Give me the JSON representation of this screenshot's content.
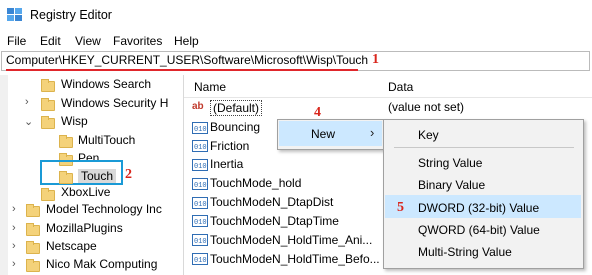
{
  "window": {
    "title": "Registry Editor"
  },
  "menu": [
    "File",
    "Edit",
    "View",
    "Favorites",
    "Help"
  ],
  "address": {
    "path": "Computer\\HKEY_CURRENT_USER\\Software\\Microsoft\\Wisp\\Touch"
  },
  "annotations": {
    "n1": "1",
    "n2": "2",
    "n4": "4",
    "n5": "5",
    "color": "#d9261c"
  },
  "tree": {
    "windows_search": "Windows Search",
    "windows_security": "Windows Security H",
    "wisp": "Wisp",
    "multitouch": "MultiTouch",
    "pen": "Pen",
    "touch": "Touch",
    "xboxlive": "XboxLive",
    "model_tech": "Model Technology Inc",
    "mozilla": "MozillaPlugins",
    "netscape": "Netscape",
    "nicomak": "Nico Mak Computing"
  },
  "columns": {
    "name": "Name",
    "data": "Data"
  },
  "values": [
    {
      "name": "(Default)",
      "data": "(value not set)",
      "icon": "string-value-icon"
    },
    {
      "name": "Bouncing",
      "icon": "dword-value-icon"
    },
    {
      "name": "Friction",
      "icon": "dword-value-icon"
    },
    {
      "name": "Inertia",
      "icon": "dword-value-icon"
    },
    {
      "name": "TouchMode_hold",
      "icon": "dword-value-icon"
    },
    {
      "name": "TouchModeN_DtapDist",
      "icon": "dword-value-icon"
    },
    {
      "name": "TouchModeN_DtapTime",
      "icon": "dword-value-icon"
    },
    {
      "name": "TouchModeN_HoldTime_Ani...",
      "icon": "dword-value-icon"
    },
    {
      "name": "TouchModeN_HoldTime_Befo...",
      "icon": "dword-value-icon"
    }
  ],
  "context_menu": {
    "new": "New"
  },
  "submenu": {
    "key": "Key",
    "string_value": "String Value",
    "binary_value": "Binary Value",
    "dword": "DWORD (32-bit) Value",
    "qword": "QWORD (64-bit) Value",
    "multi_string": "Multi-String Value"
  },
  "colors": {
    "highlight": "#cce8ff",
    "touch_box": "#1a9ad6",
    "address_underline": "#e0262b"
  }
}
